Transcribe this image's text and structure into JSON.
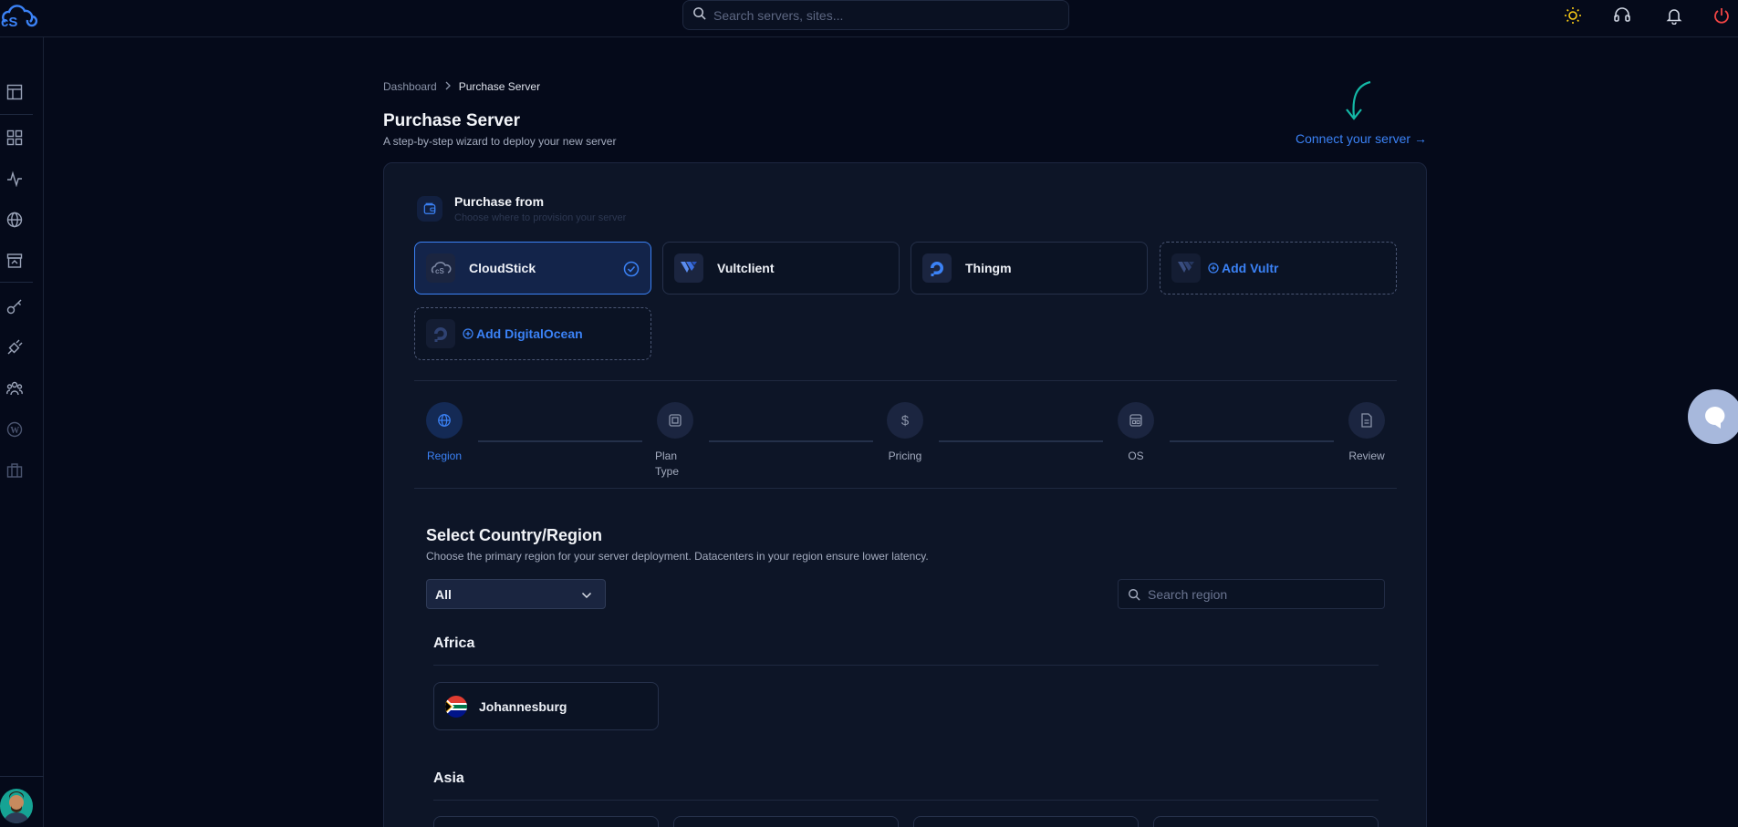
{
  "header": {
    "search_placeholder": "Search servers, sites..."
  },
  "breadcrumb": {
    "home": "Dashboard",
    "current": "Purchase Server"
  },
  "page": {
    "title": "Purchase Server",
    "subtitle": "A step-by-step wizard to deploy your new server",
    "connect_link": "Connect your server →"
  },
  "purchase_from": {
    "title": "Purchase from",
    "subtitle": "Choose where to provision your server",
    "providers": [
      {
        "label": "CloudStick",
        "icon": "cloudstick-icon",
        "selected": true
      },
      {
        "label": "Vultclient",
        "icon": "vultr-icon",
        "selected": false
      },
      {
        "label": "Thingm",
        "icon": "digitalocean-icon",
        "selected": false
      },
      {
        "label": "Add Vultr",
        "icon": "vultr-icon",
        "add": true
      },
      {
        "label": "Add DigitalOcean",
        "icon": "digitalocean-icon",
        "add": true
      }
    ]
  },
  "steps": [
    {
      "label": "Region",
      "icon": "globe-icon",
      "active": true
    },
    {
      "label": "Plan Type",
      "icon": "chip-icon",
      "active": false
    },
    {
      "label": "Pricing",
      "icon": "dollar-icon",
      "active": false
    },
    {
      "label": "OS",
      "icon": "os-icon",
      "active": false
    },
    {
      "label": "Review",
      "icon": "document-icon",
      "active": false
    }
  ],
  "region_section": {
    "title": "Select Country/Region",
    "subtitle": "Choose the primary region for your server deployment. Datacenters in your region ensure lower latency.",
    "filter_value": "All",
    "search_placeholder": "Search region"
  },
  "continents": [
    {
      "name": "Africa",
      "regions": [
        "Johannesburg"
      ]
    },
    {
      "name": "Asia",
      "regions": []
    }
  ],
  "colors": {
    "accent": "#3b82f6",
    "background": "#050a1a",
    "card": "#0d1527",
    "logout": "#ef4444"
  }
}
